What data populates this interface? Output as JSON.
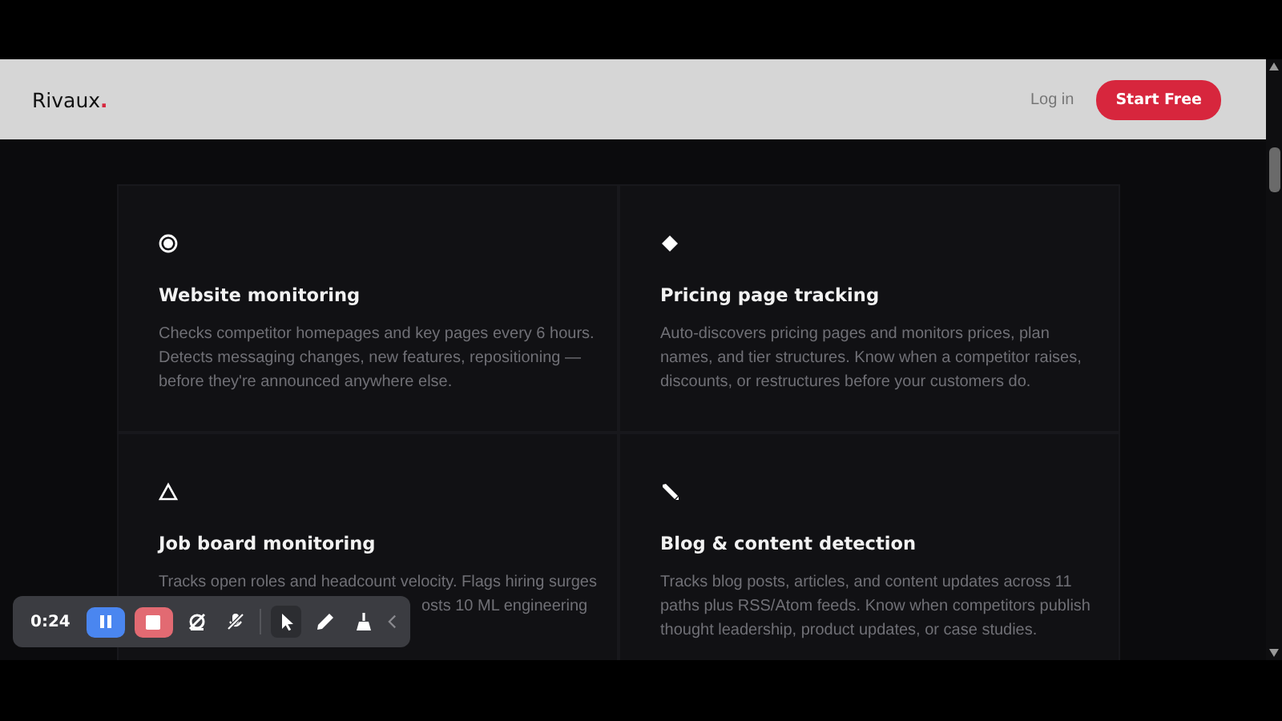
{
  "header": {
    "logo": {
      "name": "Rivaux",
      "mark": "."
    },
    "login": "Log in",
    "cta": "Start Free"
  },
  "features": [
    {
      "title": "Website monitoring",
      "lines": [
        {
          "kind": "full",
          "text": "Checks competitor homepages and key pages every 6 hours."
        },
        {
          "kind": "full",
          "text": "Detects messaging changes, new features, repositioning —"
        },
        {
          "kind": "full",
          "text": "before they're announced anywhere else."
        }
      ]
    },
    {
      "title": "Pricing page tracking",
      "lines": [
        {
          "kind": "full",
          "text": "Auto-discovers pricing pages and monitors prices, plan"
        },
        {
          "kind": "full",
          "text": "names, and tier structures. Know when a competitor raises,"
        },
        {
          "kind": "full",
          "text": "discounts, or restructures before your customers do."
        }
      ]
    },
    {
      "title": "Job board monitoring",
      "lines": [
        {
          "kind": "full",
          "text": "Tracks open roles and headcount velocity. Flags hiring surges"
        },
        {
          "kind": "partial",
          "text": "osts 10 ML engineering"
        }
      ]
    },
    {
      "title": "Blog & content detection",
      "lines": [
        {
          "kind": "full",
          "text": "Tracks blog posts, articles, and content updates across 11"
        },
        {
          "kind": "full",
          "text": "paths plus RSS/Atom feeds. Know when competitors publish"
        },
        {
          "kind": "full",
          "text": "thought leadership, product updates, or case studies."
        }
      ]
    }
  ],
  "recorder": {
    "time": "0:24",
    "tools": [
      {
        "selected": true
      },
      {
        "selected": false
      },
      {
        "selected": false
      }
    ]
  }
}
